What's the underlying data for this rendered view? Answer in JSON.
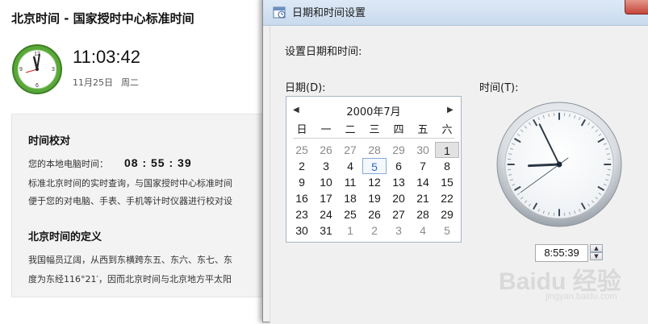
{
  "webpage": {
    "title": "北京时间 - 国家授时中心标准时间",
    "current_time": "11:03:42",
    "date": "11月25日",
    "weekday": "周二",
    "sections": {
      "calibration": {
        "heading": "时间校对",
        "local_label": "您的本地电脑时间：",
        "local_time": "08 : 55 : 39",
        "line1": "标准北京时间的实时查询，与国家授时中心标准时间",
        "line2": "便于您的对电脑、手表、手机等计时仪器进行校对设"
      },
      "definition": {
        "heading": "北京时间的定义",
        "line1": "我国幅员辽阔，从西到东横跨东五、东六、东七、东",
        "line2": "度为东经116°21′，因而北京时间与北京地方平太阳"
      }
    }
  },
  "dialog": {
    "title": "日期和时间设置",
    "instruction": "设置日期和时间:",
    "date_label": "日期(D):",
    "time_label": "时间(T):",
    "calendar": {
      "month_title": "2000年7月",
      "prev_glyph": "◀",
      "next_glyph": "▶",
      "weekdays": [
        "日",
        "一",
        "二",
        "三",
        "四",
        "五",
        "六"
      ],
      "weeks": [
        [
          "25",
          "26",
          "27",
          "28",
          "29",
          "30",
          "1"
        ],
        [
          "2",
          "3",
          "4",
          "5",
          "6",
          "7",
          "8"
        ],
        [
          "9",
          "10",
          "11",
          "12",
          "13",
          "14",
          "15"
        ],
        [
          "16",
          "17",
          "18",
          "19",
          "20",
          "21",
          "22"
        ],
        [
          "23",
          "24",
          "25",
          "26",
          "27",
          "28",
          "29"
        ],
        [
          "30",
          "31",
          "1",
          "2",
          "3",
          "4",
          "5"
        ]
      ],
      "selected_day": "1",
      "today_day": "5"
    },
    "time_value": "8:55:39",
    "spin_up": "▲",
    "spin_down": "▼",
    "clock": {
      "hour": 8,
      "minute": 55,
      "second": 39
    }
  },
  "watermark": {
    "main": "Baidu 经验",
    "sub": "jingyan.baidu.com"
  },
  "colors": {
    "accent_blue": "#2b6cc4",
    "clock_green": "#4a9b2c",
    "titlebar": "#c9daee"
  }
}
